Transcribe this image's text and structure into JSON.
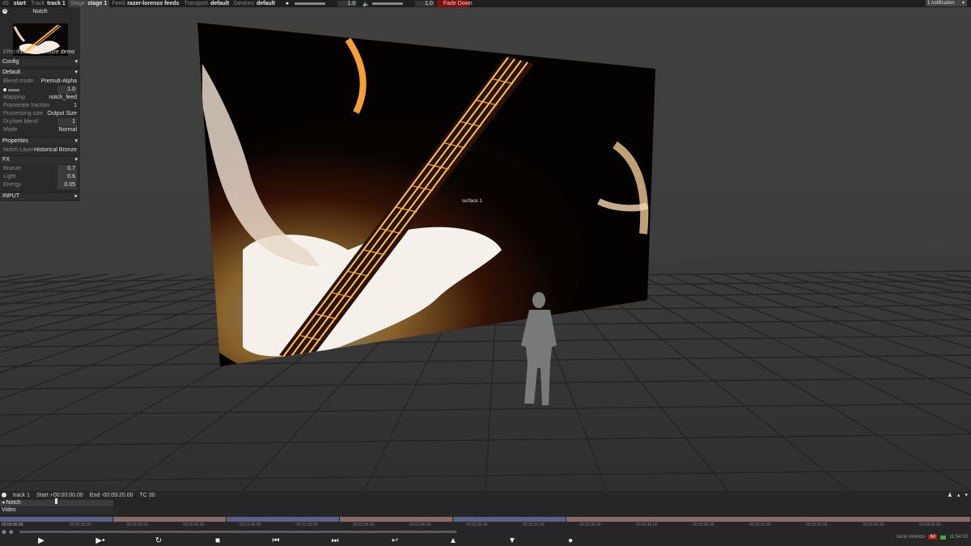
{
  "topbar": {
    "app": "d3",
    "start": "start",
    "track_label": "Track",
    "track_value": "track 1",
    "stage_label": "Stage",
    "stage_value": "stage 1",
    "feed_label": "Feed",
    "feed_value": "razer-lorenzo feeds",
    "transport_label": "Transport",
    "transport_value": "default",
    "devices_label": "Devices",
    "devices_value": "default",
    "brightness_value": "1.0",
    "volume_value": "1.0",
    "fade_down": "Fade Down",
    "notification": "1 notification",
    "fade_color": "#7a1010"
  },
  "panel": {
    "title": "Notch",
    "effect_label": "Effect",
    "effect_value": "historical bronze demo v6",
    "config": "Config",
    "default": "Default",
    "blend_mode_label": "Blend mode",
    "blend_mode_value": "Premult-Alpha",
    "opacity_value": "1.0",
    "mapping_label": "Mapping",
    "mapping_value": "notch_feed",
    "framerate_label": "Framerate fraction",
    "framerate_value": "1",
    "processing_label": "Processing size",
    "processing_value": "Output Size",
    "drywet_label": "Dry/wet blend",
    "drywet_value": "1",
    "mode_label": "Mode",
    "mode_value": "Normal",
    "properties": "Properties",
    "notch_layer_label": "Notch Layer",
    "notch_layer_value": "Historical Bronze",
    "fx": "FX",
    "bronze_label": "Bronze",
    "bronze_value": "0.7",
    "light_label": "Light",
    "light_value": "0.6",
    "energy_label": "Energy",
    "energy_value": "0.05",
    "input": "INPUT"
  },
  "viewport": {
    "surface_label": "surface 1"
  },
  "timeline": {
    "track": "track 1",
    "start": "Start +00:00:00.00",
    "end": "End -00:09:20.00",
    "tc": "TC 30",
    "layer_notch": "Notch",
    "layer_video": "Video",
    "time_left": "00:00:00.00",
    "ruler": [
      "00:00:15.00",
      "00:00:30.00",
      "00:00:45.00",
      "00:01:00.00",
      "00:01:15.00",
      "00:01:30.00",
      "00:01:45.00",
      "00:02:00.00",
      "00:02:15.00",
      "00:02:30.00",
      "00:02:45.00",
      "00:03:00.00",
      "00:03:15.00",
      "00:03:30.00",
      "00:03:45.00",
      "00:04:00.00",
      "00:04:15.00"
    ],
    "blue_color": "#5a5f8a",
    "pink_color": "#8a6868"
  },
  "status": {
    "machine": "razer-lorenzo",
    "fps": "60",
    "clock": "11:54:53"
  }
}
